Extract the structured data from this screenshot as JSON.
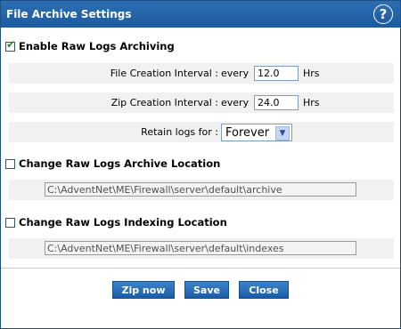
{
  "window": {
    "title": "File Archive Settings",
    "help_icon": "?"
  },
  "archiving": {
    "enable_label": "Enable Raw Logs Archiving",
    "enabled": true,
    "file_creation": {
      "label": "File Creation Interval :",
      "prefix": "every",
      "value": "12.0",
      "unit": "Hrs"
    },
    "zip_creation": {
      "label": "Zip Creation Interval :",
      "prefix": "every",
      "value": "24.0",
      "unit": "Hrs"
    },
    "retain": {
      "label": "Retain logs for :",
      "selected": "Forever"
    }
  },
  "archive_location": {
    "label": "Change Raw Logs Archive Location",
    "checked": false,
    "path": "C:\\AdventNet\\ME\\Firewall\\server\\default\\archive"
  },
  "indexing_location": {
    "label": "Change Raw Logs Indexing Location",
    "checked": false,
    "path": "C:\\AdventNet\\ME\\Firewall\\server\\default\\indexes"
  },
  "buttons": {
    "zip_now": "Zip now",
    "save": "Save",
    "close": "Close"
  },
  "colors": {
    "titlebar": "#1d5a9e",
    "button": "#2a6fb8",
    "row_bg": "#f1f1f1"
  }
}
